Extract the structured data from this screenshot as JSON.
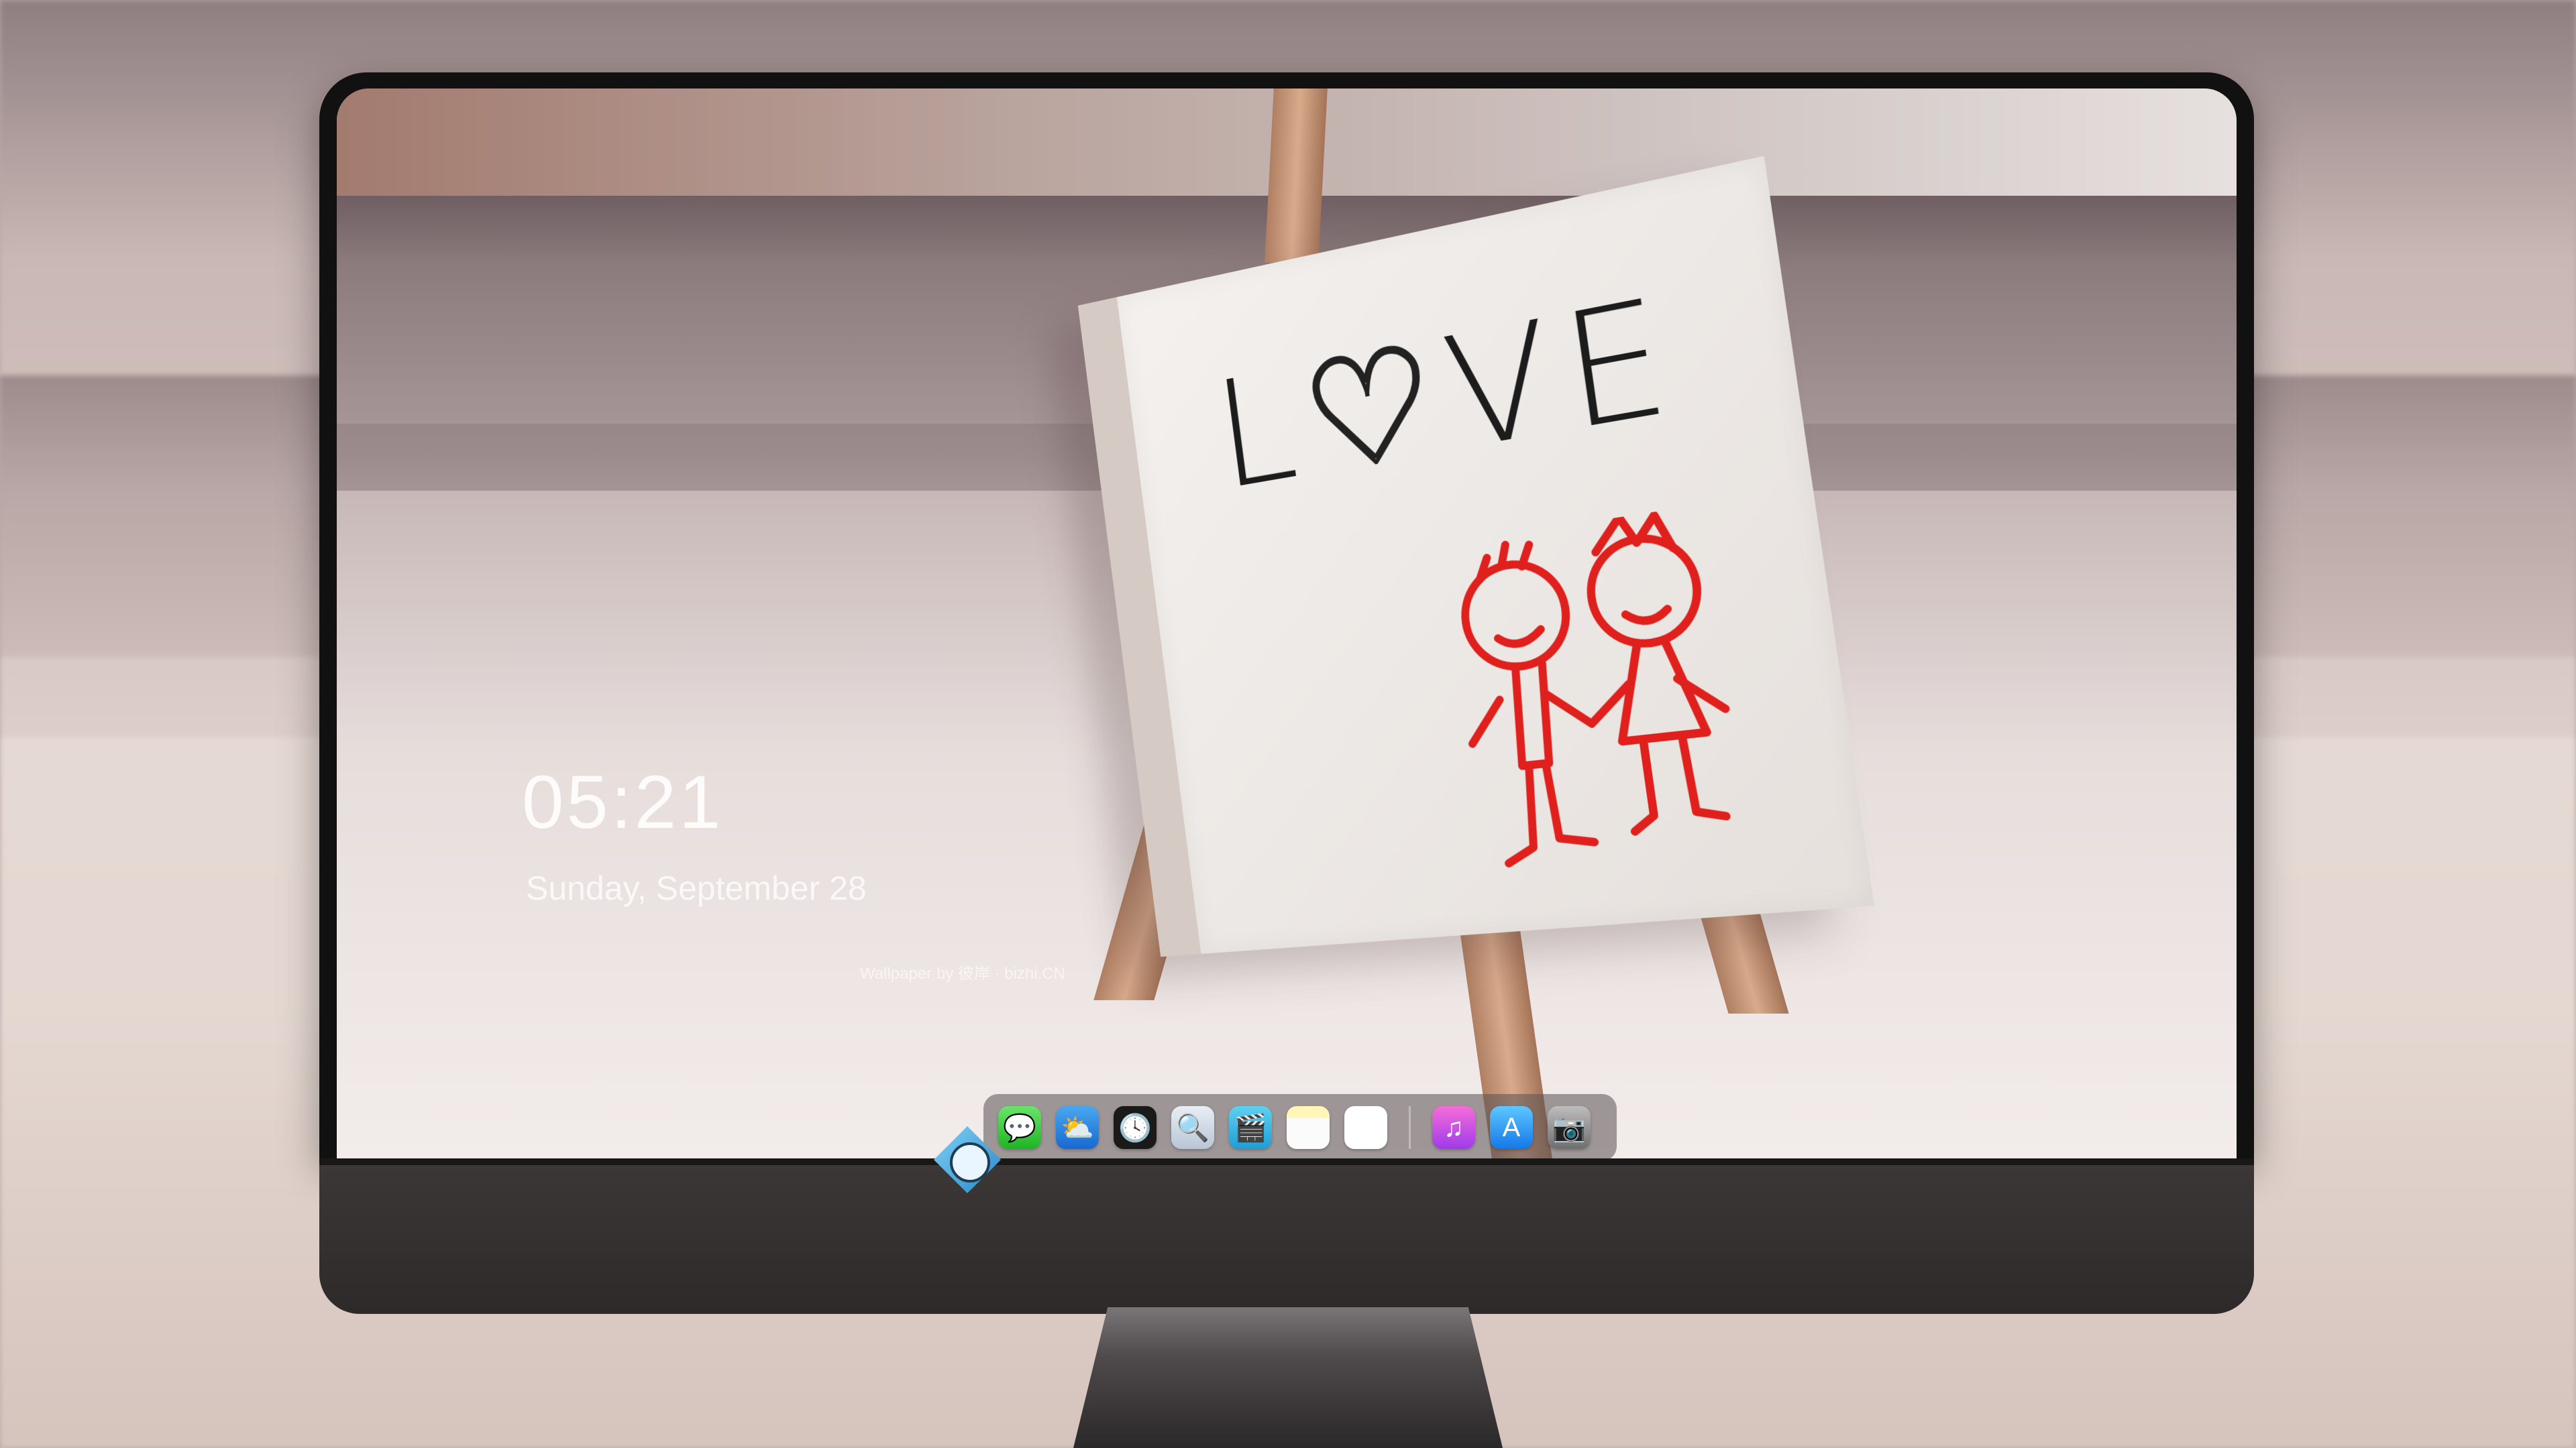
{
  "lockscreen": {
    "time": "05:21",
    "date": "Sunday, September  28",
    "credit": "Wallpaper by 彼岸 · bizhi.CN"
  },
  "wallpaper": {
    "canvas_text_left": "L",
    "canvas_text_heart": "♡",
    "canvas_text_right": "VE"
  },
  "dock": {
    "apps": [
      {
        "name": "messages-icon",
        "glyph": "💬"
      },
      {
        "name": "weather-icon",
        "glyph": "⛅"
      },
      {
        "name": "clock-icon",
        "glyph": "🕓"
      },
      {
        "name": "preview-icon",
        "glyph": "🔍"
      },
      {
        "name": "video-icon",
        "glyph": "🎬"
      },
      {
        "name": "notes-icon",
        "glyph": ""
      },
      {
        "name": "photos-icon",
        "glyph": "🖼"
      },
      {
        "name": "music-icon",
        "glyph": "♫"
      },
      {
        "name": "app-store-icon",
        "glyph": "A"
      },
      {
        "name": "camera-icon",
        "glyph": "📷"
      }
    ]
  },
  "colors": {
    "bezel": "#111111",
    "chin": "#2e2a2a",
    "drawing_red": "#e0201c"
  }
}
